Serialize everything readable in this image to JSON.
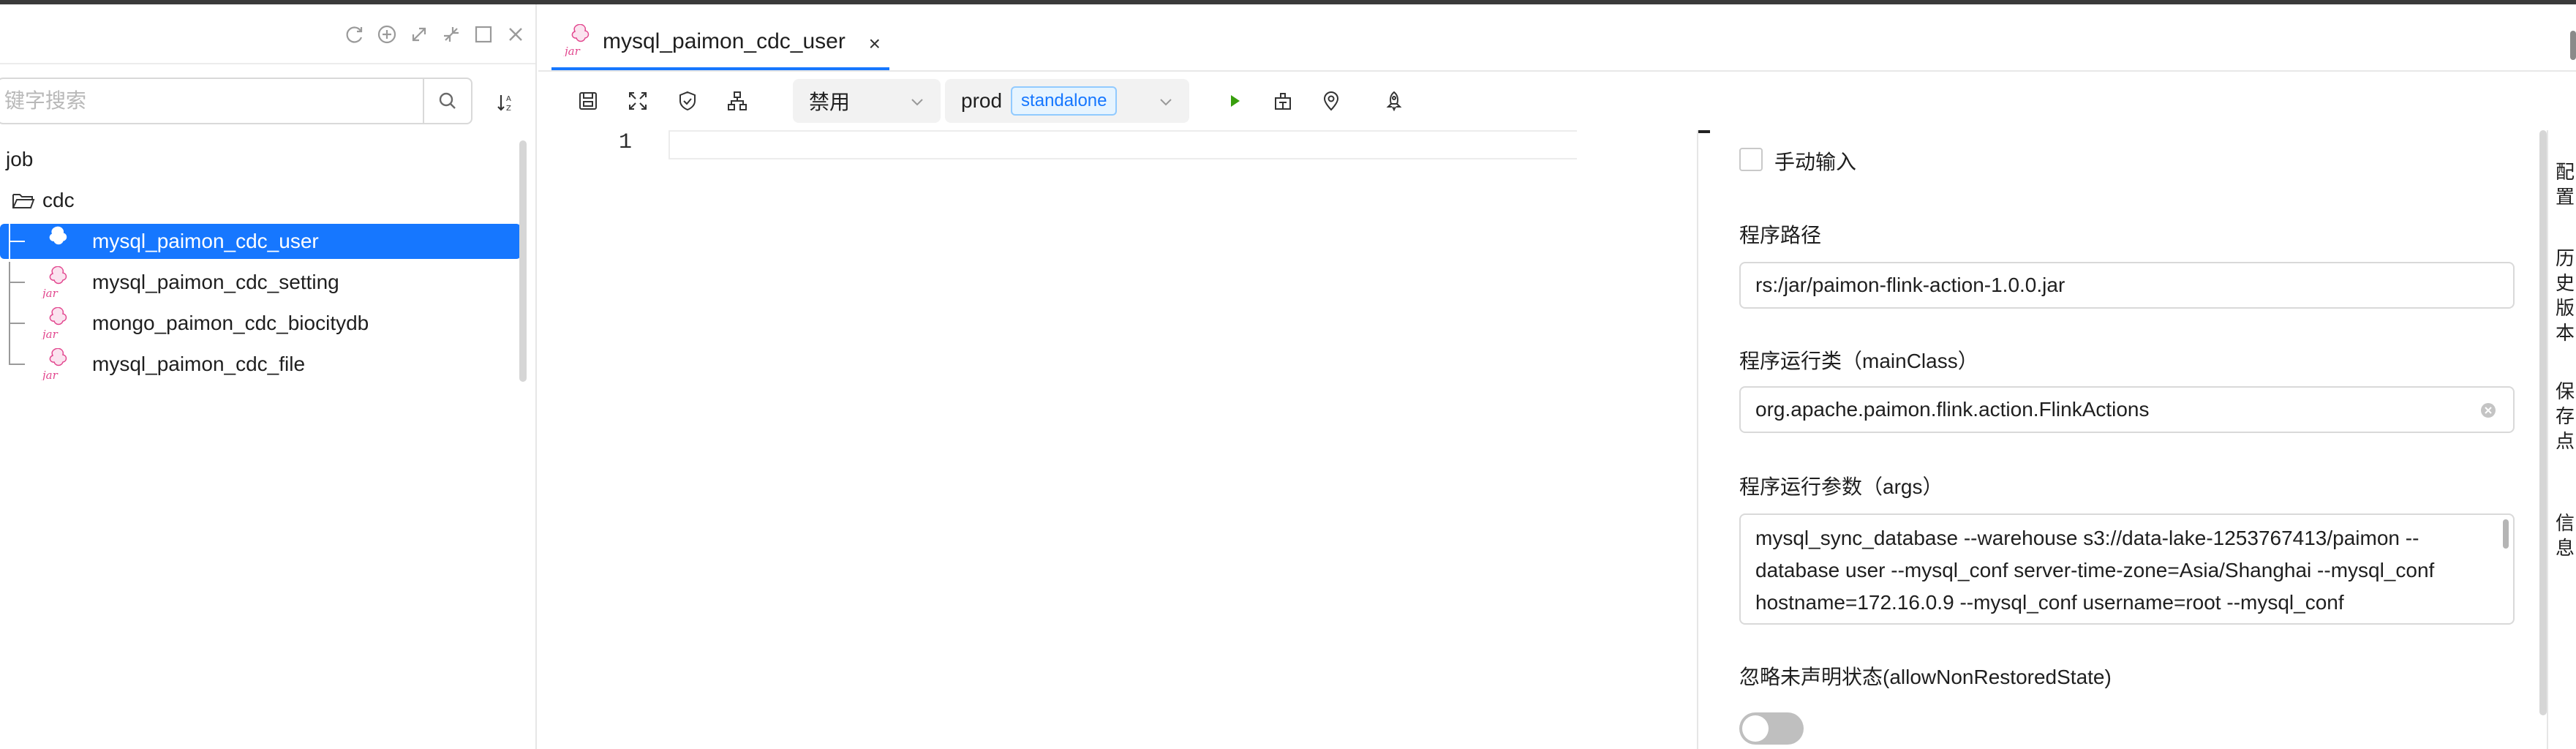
{
  "left_panel": {
    "search": {
      "placeholder": "键字搜索"
    },
    "tree": {
      "root": {
        "label": "job"
      },
      "folder": {
        "label": "cdc"
      },
      "items": [
        {
          "label": "mysql_paimon_cdc_user",
          "selected": true
        },
        {
          "label": "mysql_paimon_cdc_setting"
        },
        {
          "label": "mongo_paimon_cdc_biocitydb"
        },
        {
          "label": "mysql_paimon_cdc_file"
        }
      ]
    }
  },
  "tabs": [
    {
      "label": "mysql_paimon_cdc_user",
      "close": "×"
    }
  ],
  "toolbar": {
    "alert_select": {
      "value": "禁用"
    },
    "env_select": {
      "value": "prod",
      "tag": "standalone"
    }
  },
  "editor": {
    "line_numbers": [
      "1"
    ]
  },
  "config": {
    "manual_input_label": "手动输入",
    "jar_path": {
      "label": "程序路径",
      "value": "rs:/jar/paimon-flink-action-1.0.0.jar"
    },
    "main_class": {
      "label": "程序运行类（mainClass）",
      "value": "org.apache.paimon.flink.action.FlinkActions"
    },
    "args": {
      "label": "程序运行参数（args）",
      "lines": [
        "mysql_sync_database --warehouse s3://data-lake-1253767413/paimon --",
        "database user --mysql_conf server-time-zone=Asia/Shanghai --mysql_conf",
        "hostname=172.16.0.9 --mysql_conf username=root --mysql_conf"
      ]
    },
    "allow_non_restored": {
      "label": "忽略未声明状态(allowNonRestoredState)",
      "checked": false
    }
  },
  "side_tabs": [
    "配置",
    "历史版本",
    "保存点",
    "信息"
  ],
  "colors": {
    "primary": "#1677ff",
    "run_green": "#389e0d",
    "jar_pink": "#e2468e"
  }
}
